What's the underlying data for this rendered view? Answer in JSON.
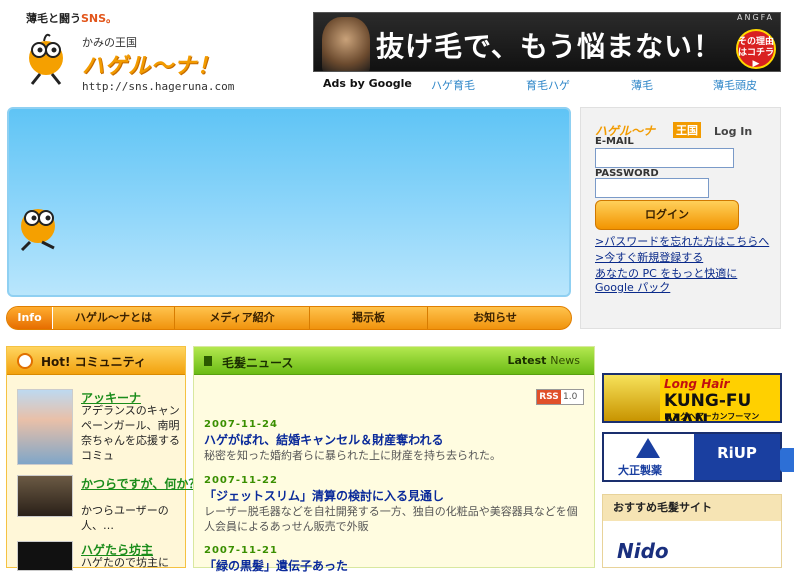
{
  "header": {
    "tagline_prefix": "薄毛と闘う",
    "tagline_sns": "SNS。",
    "logo_sub": "かみの王国",
    "logo_main": "ハゲル〜ナ！",
    "logo_url": "http://sns.hageruna.com"
  },
  "banner": {
    "text": "抜け毛で、もう悩まない！",
    "brand": "ANGFA",
    "badge": "その理由はコチラ▶"
  },
  "ads": {
    "label": "Ads by Google",
    "keywords": [
      "ハゲ育毛",
      "育毛ハゲ",
      "薄毛",
      "薄毛頭皮"
    ]
  },
  "nav": {
    "info": "Info",
    "items": [
      "ハゲル〜ナとは",
      "メディア紹介",
      "掲示板",
      "お知らせ"
    ]
  },
  "login": {
    "logo": "ハゲル〜ナ",
    "logo_kingdom": "王国",
    "title": "Log In",
    "email_label": "E-MAIL",
    "email_value": "",
    "password_label": "PASSWORD",
    "password_value": "",
    "button": "ログイン",
    "links": [
      ">パスワードを忘れた方はこちらへ",
      ">今すぐ新規登録する",
      "あなたの PC をもっと快適に",
      "Google パック"
    ]
  },
  "community": {
    "title": "Hot! コミュニティ",
    "items": [
      {
        "name": "アッキーナ",
        "desc": "アデランスのキャンペーンガール、南明奈ちゃんを応援するコミュ"
      },
      {
        "name": "かつらですが、何か？",
        "desc": "かつらユーザーの人、…"
      },
      {
        "name": "ハゲたら坊主",
        "desc": "ハゲたので坊主に"
      }
    ]
  },
  "news": {
    "title": "毛髪ニュース",
    "latest": "Latest",
    "latest_news": "News",
    "rss": "RSS",
    "rss_version": "1.0",
    "items": [
      {
        "date": "2007-11-24",
        "title": "ハゲがばれ、結婚キャンセル＆財産奪われる",
        "body": "秘密を知った婚約者らに暴られた上に財産を持ち去られた。"
      },
      {
        "date": "2007-11-22",
        "title": "「ジェットスリム」清算の検討に入る見通し",
        "body": "レーザー脱毛器などを自社開発する一方、独自の化粧品や美容器具などを個人会員によるあっせん販売で外販"
      },
      {
        "date": "2007-11-21",
        "title": "「緑の黒髪」遺伝子あった",
        "body": ""
      }
    ]
  },
  "right_ads": {
    "kfm_line1": "Long Hair",
    "kfm_line2": "KUNG-FU MAN",
    "kfm_line3": "ロングヘアーカンフーマン",
    "taisho_name": "大正製薬",
    "riup": "RiUP",
    "recommended_title": "おすすめ毛髪サイト",
    "nido": "Nido"
  }
}
